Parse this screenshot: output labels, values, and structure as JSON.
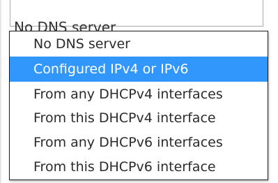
{
  "select": {
    "current_value": "No DNS server"
  },
  "dropdown": {
    "options": [
      {
        "label": "No DNS server",
        "selected": false
      },
      {
        "label": "Configured IPv4 or IPv6",
        "selected": true
      },
      {
        "label": "From any DHCPv4 interfaces",
        "selected": false
      },
      {
        "label": "From this DHCPv4 interface",
        "selected": false
      },
      {
        "label": "From any DHCPv6 interfaces",
        "selected": false
      },
      {
        "label": "From this DHCPv6 interface",
        "selected": false
      }
    ],
    "highlight_color": "#3297fd"
  }
}
